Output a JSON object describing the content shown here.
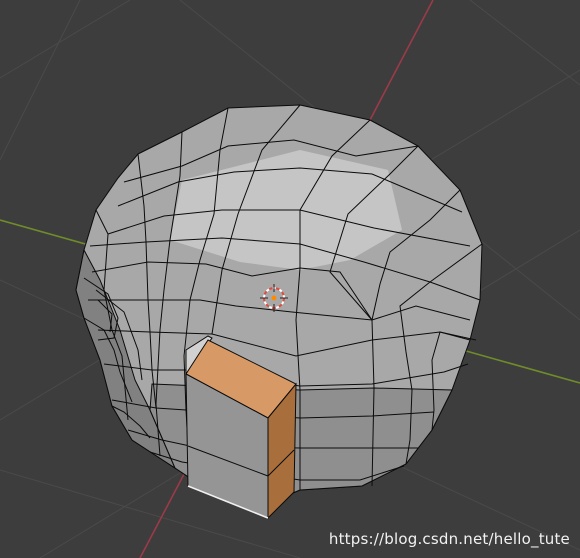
{
  "viewport": {
    "background": "#3d3d3d",
    "grid_color": "#4a4a4a",
    "axis_x_color": "#9b3a48",
    "axis_y_color": "#6f8c2b"
  },
  "mesh": {
    "face_color": "#a9a9a9",
    "edge_color": "#0b0b0b",
    "selected_face_color": "#d79a66",
    "selected_side_color": "#a86f3c"
  },
  "cursor": {
    "icon": "3d-cursor-icon",
    "ring_color_a": "#e24a3a",
    "ring_color_b": "#ffffff"
  },
  "watermark": {
    "text": "https://blog.csdn.net/hello_tute"
  }
}
